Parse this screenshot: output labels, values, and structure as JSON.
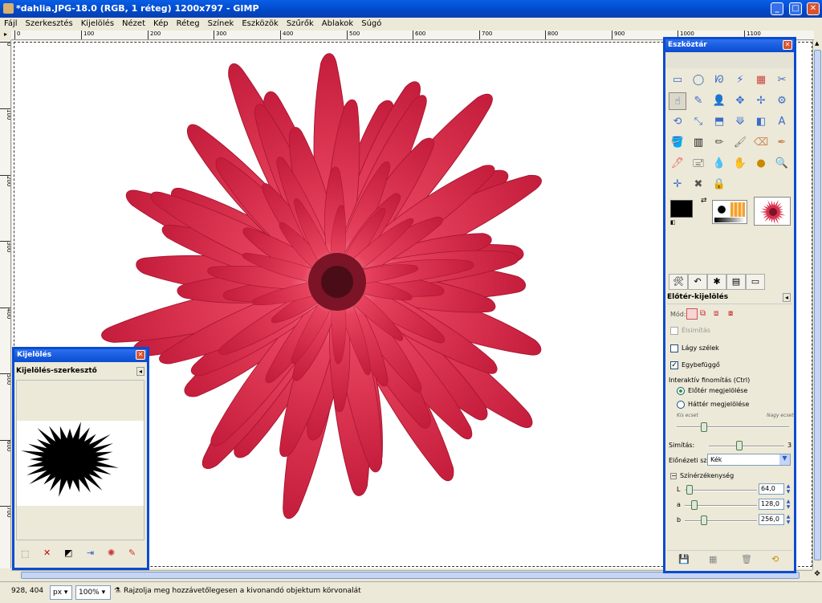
{
  "window": {
    "title": "*dahlia.JPG-18.0 (RGB, 1 réteg) 1200x797 - GIMP",
    "buttons": [
      "_",
      "□",
      "✕"
    ]
  },
  "menu": [
    "Fájl",
    "Szerkesztés",
    "Kijelölés",
    "Nézet",
    "Kép",
    "Réteg",
    "Színek",
    "Eszközök",
    "Szűrők",
    "Ablakok",
    "Súgó"
  ],
  "ruler": {
    "h_labels": [
      "0",
      "100",
      "200",
      "300",
      "400",
      "500",
      "600",
      "700",
      "800",
      "900",
      "1000",
      "1100"
    ],
    "v_labels": [
      "0",
      "100",
      "200",
      "300",
      "400",
      "500",
      "600",
      "700"
    ]
  },
  "statusbar": {
    "coords": "928, 404",
    "unit": "px",
    "zoom": "100%",
    "message": "Rajzolja meg hozzávetőlegesen a kivonandó objektum körvonalát"
  },
  "toolbox": {
    "title": "Eszköztár",
    "tools": [
      "▭",
      "◯",
      "ᘗ",
      "⚡",
      "▦",
      "✂",
      "☝",
      "✎",
      "👤",
      "✥",
      "✢",
      "⚙",
      "⟲",
      "⤡",
      "⬒",
      "⟱",
      "◧",
      "A",
      "🪣",
      "▥",
      "✏",
      "🖌",
      "⌫",
      "✒",
      "🖊",
      "🖃",
      "💧",
      "✋",
      "●",
      "🔍",
      "✛",
      "✖",
      "🔒"
    ],
    "fg_color": "#000000",
    "bg_color": "#ffffff",
    "options": {
      "title": "Előtér-kijelölés",
      "mode_label": "Mód:",
      "antialias_label": "Élsimítás",
      "feather_label": "Lágy szélek",
      "contiguous_label": "Egybefüggő",
      "contiguous_checked": true,
      "interactive_label": "Interaktív finomítás  (Ctrl)",
      "radio_fg": "Előtér megjelölése",
      "radio_bg": "Háttér megjelölése",
      "small_brush": "Kis ecset",
      "large_brush": "Nagy ecset",
      "smoothing_label": "Simítás:",
      "smoothing_value": "3",
      "preview_color_label": "Előnézeti szín:",
      "preview_color_value": "Kék",
      "sensitivity_label": "Színérzékenység",
      "l_label": "L",
      "l_value": "64,0",
      "a_label": "a",
      "a_value": "128,0",
      "b_label": "b",
      "b_value": "256,0"
    }
  },
  "selection_editor": {
    "window_title": "Kijelölés",
    "panel_title": "Kijelölés-szerkesztő"
  }
}
